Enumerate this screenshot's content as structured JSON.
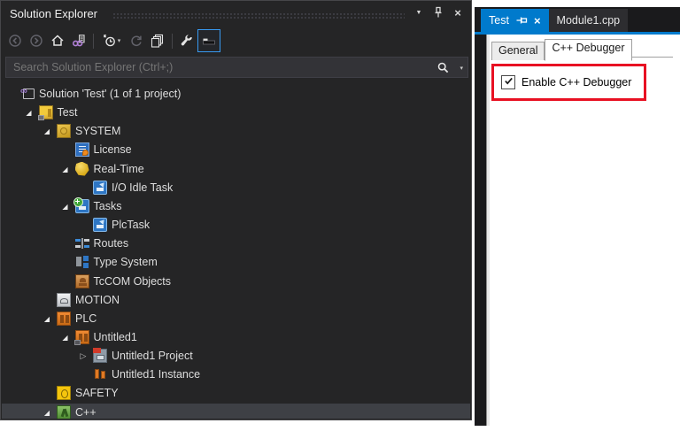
{
  "solution_explorer": {
    "title": "Solution Explorer",
    "title_buttons": [
      {
        "name": "window-position-caret-icon"
      },
      {
        "name": "pin-icon"
      },
      {
        "name": "close-icon"
      }
    ],
    "toolbar": [
      {
        "name": "back-icon",
        "disabled": true
      },
      {
        "name": "forward-icon",
        "disabled": true
      },
      {
        "name": "home-icon"
      },
      {
        "name": "sync-with-active-document-icon"
      },
      {
        "type": "separator"
      },
      {
        "name": "pending-changes-filter-icon",
        "has_dropdown": true
      },
      {
        "name": "refresh-icon",
        "disabled": true
      },
      {
        "name": "collapse-all-icon"
      },
      {
        "type": "separator"
      },
      {
        "name": "properties-icon"
      },
      {
        "name": "preview-selected-items-icon",
        "active": true
      }
    ],
    "search": {
      "placeholder": "Search Solution Explorer (Ctrl+;)"
    },
    "tree": [
      {
        "label": "Solution 'Test' (1 of 1 project)",
        "depth": 0,
        "icon": "solution-icon"
      },
      {
        "label": "Test",
        "depth": 1,
        "state": "expanded",
        "icon": "tc-project-icon"
      },
      {
        "label": "SYSTEM",
        "depth": 2,
        "state": "expanded",
        "icon": "system-icon"
      },
      {
        "label": "License",
        "depth": 3,
        "icon": "license-icon"
      },
      {
        "label": "Real-Time",
        "depth": 3,
        "state": "expanded",
        "icon": "realtime-icon"
      },
      {
        "label": "I/O Idle Task",
        "depth": 4,
        "icon": "task-icon"
      },
      {
        "label": "Tasks",
        "depth": 3,
        "state": "expanded",
        "icon": "tasks-icon"
      },
      {
        "label": "PlcTask",
        "depth": 4,
        "icon": "task-icon"
      },
      {
        "label": "Routes",
        "depth": 3,
        "icon": "routes-icon"
      },
      {
        "label": "Type System",
        "depth": 3,
        "icon": "type-system-icon"
      },
      {
        "label": "TcCOM Objects",
        "depth": 3,
        "icon": "tccom-icon"
      },
      {
        "label": "MOTION",
        "depth": 2,
        "icon": "motion-icon"
      },
      {
        "label": "PLC",
        "depth": 2,
        "state": "expanded",
        "icon": "plc-icon"
      },
      {
        "label": "Untitled1",
        "depth": 3,
        "state": "expanded",
        "icon": "plc-project-icon"
      },
      {
        "label": "Untitled1 Project",
        "depth": 4,
        "state": "collapsed",
        "icon": "plc-doc-icon"
      },
      {
        "label": "Untitled1 Instance",
        "depth": 4,
        "icon": "plc-instance-icon"
      },
      {
        "label": "SAFETY",
        "depth": 2,
        "icon": "safety-icon"
      },
      {
        "label": "C++",
        "depth": 2,
        "state": "expanded",
        "icon": "cpp-icon",
        "selected": true
      }
    ]
  },
  "editor": {
    "document_tabs": [
      {
        "label": "Test",
        "active": true,
        "icons": [
          "pin-icon",
          "close-icon"
        ]
      },
      {
        "label": "Module1.cpp",
        "active": false
      }
    ],
    "property_tabs": [
      {
        "label": "General",
        "active": false
      },
      {
        "label": "C++ Debugger",
        "active": true
      }
    ],
    "debugger_checkbox": {
      "label": "Enable C++ Debugger",
      "checked": true,
      "highlighted": true
    }
  },
  "colors": {
    "accent": "#007acc",
    "panel_background": "#252526",
    "selected_row": "#3e4045",
    "highlight_box": "#e81123"
  }
}
